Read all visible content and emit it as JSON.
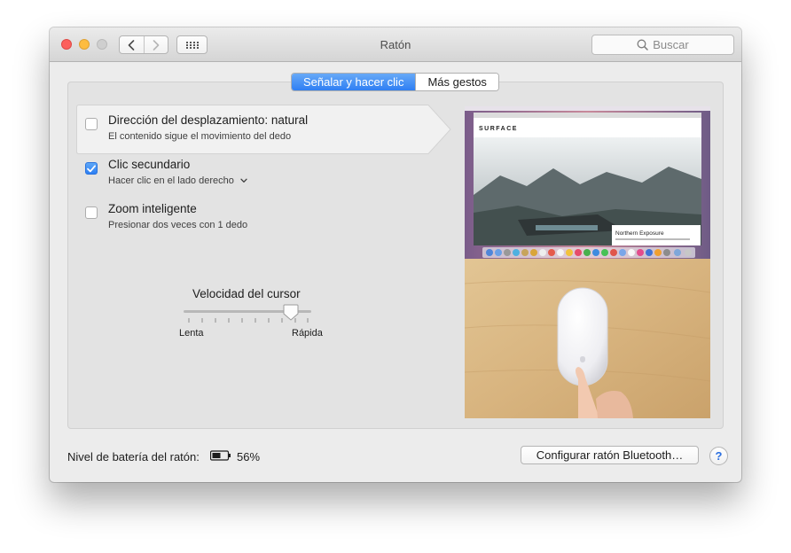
{
  "window": {
    "title": "Ratón"
  },
  "search": {
    "placeholder": "Buscar"
  },
  "tabs": [
    {
      "label": "Señalar y hacer clic",
      "active": true
    },
    {
      "label": "Más gestos",
      "active": false
    }
  ],
  "options": [
    {
      "title": "Dirección del desplazamiento: natural",
      "subtitle": "El contenido sigue el movimiento del dedo",
      "checked": false
    },
    {
      "title": "Clic secundario",
      "subtitle": "Hacer clic en el lado derecho",
      "checked": true
    },
    {
      "title": "Zoom inteligente",
      "subtitle": "Presionar dos veces con 1 dedo",
      "checked": false
    }
  ],
  "tracking": {
    "label": "Velocidad del cursor",
    "min_label": "Lenta",
    "max_label": "Rápida",
    "value_fraction": 0.85
  },
  "preview": {
    "site_brand": "SURFACE",
    "caption_title": "Northern Exposure"
  },
  "battery": {
    "label": "Nivel de batería del ratón:",
    "percent": "56%",
    "level": 0.56
  },
  "buttons": {
    "configure": "Configurar ratón Bluetooth…",
    "help": "?"
  },
  "colors": {
    "accent": "#2f7ff3",
    "close": "#fc605c",
    "minimize": "#fdbc40"
  },
  "icons": [
    "back-chevron-icon",
    "forward-chevron-icon",
    "grid-icon",
    "search-icon",
    "checkmark-icon",
    "chevron-down-icon",
    "battery-icon",
    "slider-knob-icon"
  ]
}
